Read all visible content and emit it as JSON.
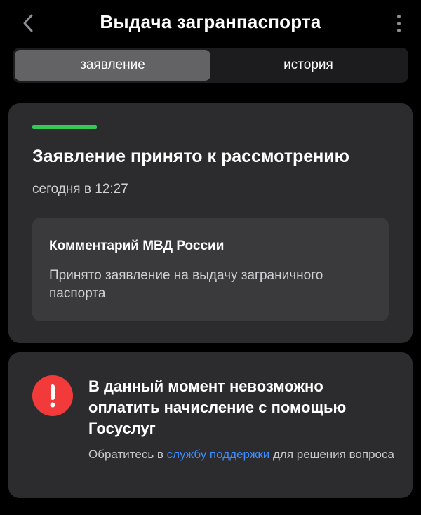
{
  "header": {
    "title": "Выдача загранпаспорта",
    "back_icon": "chevron-left-icon",
    "more_icon": "more-vertical-icon"
  },
  "tabs": [
    {
      "label": "заявление",
      "active": true
    },
    {
      "label": "история",
      "active": false
    }
  ],
  "status": {
    "bar_color": "#34c759",
    "title": "Заявление принято к рассмотрению",
    "time": "сегодня в 12:27",
    "comment": {
      "title": "Комментарий МВД России",
      "text": "Принято заявление на выдачу заграничного паспорта"
    }
  },
  "warning": {
    "icon": "exclamation-icon",
    "icon_color": "#f23a3a",
    "title": "В данный момент невозможно оплатить начисление с помощью Госуслуг",
    "text_before": "Обратитесь в ",
    "link": "службу поддержки",
    "text_after": " для решения вопроса",
    "link_color": "#3c8cff"
  }
}
